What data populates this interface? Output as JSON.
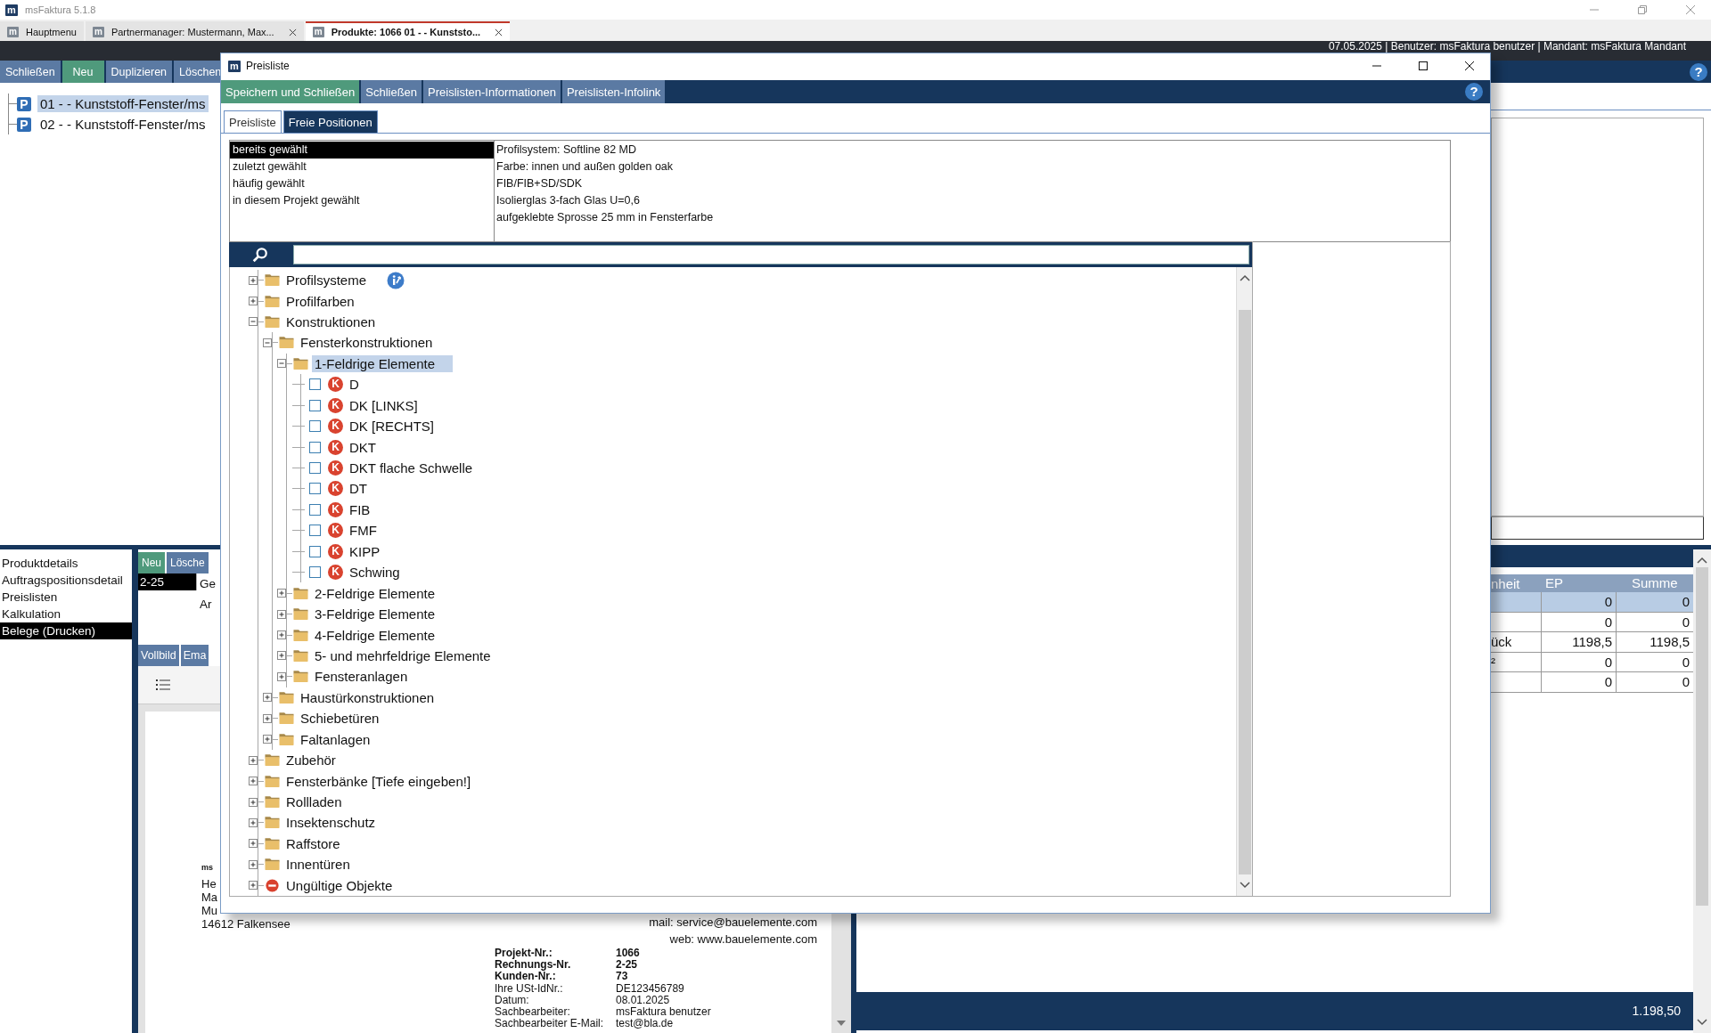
{
  "app": {
    "title": "msFaktura 5.1.8",
    "logo": "m",
    "help": "?"
  },
  "doc_tabs": [
    {
      "icon": "m",
      "label": "Hauptmenu",
      "closable": false,
      "selected": false
    },
    {
      "icon": "m",
      "label": "Partnermanager: Mustermann, Max...",
      "closable": true,
      "selected": false
    },
    {
      "icon": "m",
      "label": "Produkte: 1066 01 - - Kunststo...",
      "closable": true,
      "selected": true
    }
  ],
  "info_bar": "07.05.2025 | Benutzer: msFaktura benutzer | Mandant: msFaktura Mandant",
  "toolbar": [
    {
      "label": "Schließen",
      "kind": "normal"
    },
    {
      "label": "Neu",
      "kind": "primary"
    },
    {
      "label": "Duplizieren",
      "kind": "normal"
    },
    {
      "label": "Löschen",
      "kind": "normal"
    }
  ],
  "products": [
    {
      "badge": "P",
      "label": "01 - - Kunststoff-Fenster/ms",
      "selected": true
    },
    {
      "badge": "P",
      "label": "02 -  - Kunststoff-Fenster/ms",
      "selected": false
    }
  ],
  "nav": [
    {
      "label": "Produktdetails",
      "selected": false
    },
    {
      "label": "Auftragspositionsdetail",
      "selected": false
    },
    {
      "label": "Preislisten",
      "selected": false
    },
    {
      "label": "Kalkulation",
      "selected": false
    },
    {
      "label": "Belege (Drucken)",
      "selected": true
    }
  ],
  "belege": {
    "buttons": [
      {
        "label": "Neu",
        "kind": "primary"
      },
      {
        "label": "Lösche",
        "kind": "normal"
      }
    ],
    "rows": [
      {
        "number": "2-25",
        "column_2": [
          "Ge",
          "Ar"
        ],
        "selected": true
      }
    ],
    "view_buttons": [
      "Vollbild",
      "Ema"
    ]
  },
  "document": {
    "sender": "ms",
    "address": [
      "He",
      "Ma",
      "Mu",
      "14612 Falkensee"
    ],
    "contact": [
      "mail: service@bauelemente.com",
      "web: www.bauelemente.com"
    ],
    "info": [
      {
        "label": "Projekt-Nr.:",
        "value": "1066",
        "bold": true
      },
      {
        "label": "Rechnungs-Nr.",
        "value": "2-25",
        "bold": true
      },
      {
        "label": "Kunden-Nr.:",
        "value": "73",
        "bold": true
      },
      {
        "label": "Ihre USt-IdNr.:",
        "value": "DE123456789",
        "bold": false
      },
      {
        "label": "Datum:",
        "value": "08.01.2025",
        "bold": false
      },
      {
        "label": "Sachbearbeiter:",
        "value": "msFaktura benutzer",
        "bold": false
      },
      {
        "label": "Sachbearbeiter E-Mail:",
        "value": "test@bla.de",
        "bold": false
      }
    ]
  },
  "positions": {
    "columns": [
      "nheit",
      "EP",
      "Summe"
    ],
    "rows": [
      {
        "ep": "0",
        "summe": "0",
        "selected": true
      },
      {
        "ep": "0",
        "summe": "0",
        "selected": false
      },
      {
        "unit": "ück",
        "ep": "1198,5",
        "summe": "1198,5",
        "selected": false
      },
      {
        "unit": "²",
        "ep": "0",
        "summe": "0",
        "selected": false
      },
      {
        "ep": "0",
        "summe": "0",
        "selected": false
      }
    ],
    "total": "1.198,50"
  },
  "dialog": {
    "logo": "m",
    "title": "Preisliste",
    "help": "?",
    "toolbar": [
      {
        "label": "Speichern und Schließen",
        "kind": "primary"
      },
      {
        "label": "Schließen",
        "kind": "normal"
      },
      {
        "label": "Preislisten-Informationen",
        "kind": "normal"
      },
      {
        "label": "Preislisten-Infolink",
        "kind": "normal"
      }
    ],
    "tabs": [
      {
        "label": "Preisliste",
        "selected": true
      },
      {
        "label": "Freie Positionen",
        "selected": false
      }
    ],
    "filters": [
      {
        "label": "bereits gewählt",
        "selected": true
      },
      {
        "label": "zuletzt gewählt",
        "selected": false
      },
      {
        "label": "häufig gewählt",
        "selected": false
      },
      {
        "label": "in diesem Projekt gewählt",
        "selected": false
      }
    ],
    "description": [
      "Profilsystem: Softline 82 MD",
      "Farbe: innen und außen golden oak",
      "FIB/FIB+SD/SDK",
      "Isolierglas 3-fach Glas U=0,6",
      "aufgeklebte Sprosse 25 mm in Fensterfarbe"
    ],
    "tree": [
      {
        "label": "Profilsysteme",
        "kind": "folder",
        "expanded": false,
        "selected": false,
        "info": true
      },
      {
        "label": "Profilfarben",
        "kind": "folder",
        "expanded": false,
        "selected": false
      },
      {
        "label": "Konstruktionen",
        "kind": "folder",
        "expanded": true,
        "selected": false,
        "children": [
          {
            "label": "Fensterkonstruktionen",
            "kind": "folder",
            "expanded": true,
            "selected": false,
            "children": [
              {
                "label": "1-Feldrige Elemente",
                "kind": "folder",
                "expanded": true,
                "selected": true,
                "children": [
                  {
                    "label": "D",
                    "kind": "article",
                    "badge": "K",
                    "checked": false,
                    "selected": false
                  },
                  {
                    "label": "DK [LINKS]",
                    "kind": "article",
                    "badge": "K",
                    "checked": false,
                    "selected": false
                  },
                  {
                    "label": "DK [RECHTS]",
                    "kind": "article",
                    "badge": "K",
                    "checked": false,
                    "selected": false
                  },
                  {
                    "label": "DKT",
                    "kind": "article",
                    "badge": "K",
                    "checked": false,
                    "selected": false
                  },
                  {
                    "label": "DKT flache Schwelle",
                    "kind": "article",
                    "badge": "K",
                    "checked": false,
                    "selected": false
                  },
                  {
                    "label": "DT",
                    "kind": "article",
                    "badge": "K",
                    "checked": false,
                    "selected": false
                  },
                  {
                    "label": "FIB",
                    "kind": "article",
                    "badge": "K",
                    "checked": false,
                    "selected": false
                  },
                  {
                    "label": "FMF",
                    "kind": "article",
                    "badge": "K",
                    "checked": false,
                    "selected": false
                  },
                  {
                    "label": "KIPP",
                    "kind": "article",
                    "badge": "K",
                    "checked": false,
                    "selected": false
                  },
                  {
                    "label": "Schwing",
                    "kind": "article",
                    "badge": "K",
                    "checked": false,
                    "selected": false
                  }
                ]
              },
              {
                "label": "2-Feldrige Elemente",
                "kind": "folder",
                "expanded": false,
                "selected": false
              },
              {
                "label": "3-Feldrige Elemente",
                "kind": "folder",
                "expanded": false,
                "selected": false
              },
              {
                "label": "4-Feldrige Elemente",
                "kind": "folder",
                "expanded": false,
                "selected": false
              },
              {
                "label": "5- und mehrfeldrige Elemente",
                "kind": "folder",
                "expanded": false,
                "selected": false
              },
              {
                "label": "Fensteranlagen",
                "kind": "folder",
                "expanded": false,
                "selected": false
              }
            ]
          },
          {
            "label": "Haustürkonstruktionen",
            "kind": "folder",
            "expanded": false,
            "selected": false
          },
          {
            "label": "Schiebetüren",
            "kind": "folder",
            "expanded": false,
            "selected": false
          },
          {
            "label": "Faltanlagen",
            "kind": "folder",
            "expanded": false,
            "selected": false
          }
        ]
      },
      {
        "label": "Zubehör",
        "kind": "folder",
        "expanded": false,
        "selected": false
      },
      {
        "label": "Fensterbänke [Tiefe eingeben!]",
        "kind": "folder",
        "expanded": false,
        "selected": false
      },
      {
        "label": "Rollladen",
        "kind": "folder",
        "expanded": false,
        "selected": false
      },
      {
        "label": "Insektenschutz",
        "kind": "folder",
        "expanded": false,
        "selected": false
      },
      {
        "label": "Raffstore",
        "kind": "folder",
        "expanded": false,
        "selected": false
      },
      {
        "label": "Innentüren",
        "kind": "folder",
        "expanded": false,
        "selected": false
      },
      {
        "label": "Ungültige Objekte",
        "kind": "invalid",
        "expanded": false,
        "selected": false
      }
    ]
  }
}
